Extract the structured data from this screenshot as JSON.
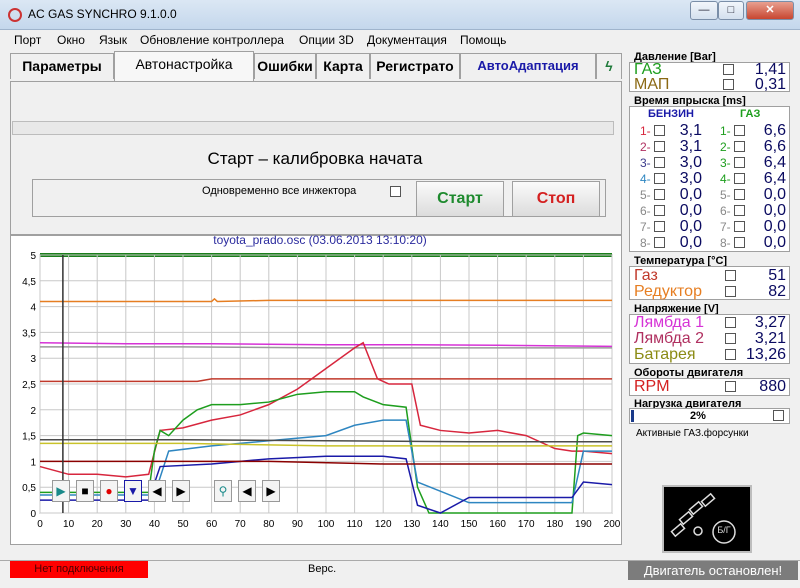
{
  "window": {
    "title": "AC GAS SYNCHRO  9.1.0.0",
    "minimize": "—",
    "maximize": "□",
    "close": "✕"
  },
  "menu": [
    "Порт",
    "Окно",
    "Язык",
    "Обновление контроллера",
    "Опции 3D",
    "Документация",
    "Помощь"
  ],
  "tabs": [
    "Параметры",
    "Автонастройка",
    "Ошибки",
    "Карта",
    "Регистрато",
    "АвтоАдаптация"
  ],
  "autotune": {
    "status": "Старт – калибровка начата",
    "all_injectors_label": "Одновременно все инжектора",
    "start_label": "Старт",
    "stop_label": "Стоп"
  },
  "chart_header": "toyota_prado.osc   (03.06.2013 13:10:20)",
  "chart_data": {
    "type": "line",
    "ylim": [
      0,
      5
    ],
    "xlim": [
      0,
      200
    ],
    "xticks": [
      "0",
      "10",
      "20",
      "30",
      "40",
      "50",
      "60",
      "70",
      "80",
      "90",
      "100",
      "110",
      "120",
      "130",
      "140",
      "150",
      "160",
      "170",
      "180",
      "190",
      "200"
    ],
    "yticks": [
      "0",
      "0,5",
      "1",
      "1,5",
      "2",
      "2,5",
      "3",
      "3,5",
      "4",
      "4,5",
      "5"
    ],
    "cursor_x": 8,
    "series": [
      {
        "color": "#e67e22",
        "x": [
          0,
          20,
          40,
          60,
          61,
          62,
          80,
          100,
          130,
          160,
          200
        ],
        "y": [
          4.1,
          4.1,
          4.1,
          4.1,
          4.15,
          4.1,
          4.12,
          4.12,
          4.12,
          4.12,
          4.12
        ]
      },
      {
        "color": "#d633d6",
        "x": [
          0,
          30,
          60,
          100,
          130,
          160,
          200
        ],
        "y": [
          3.3,
          3.28,
          3.28,
          3.26,
          3.26,
          3.25,
          3.23
        ]
      },
      {
        "color": "#9a9a9a",
        "x": [
          0,
          50,
          100,
          150,
          200
        ],
        "y": [
          3.22,
          3.22,
          3.2,
          3.2,
          3.2
        ]
      },
      {
        "color": "#c0392b",
        "x": [
          0,
          50,
          55,
          60,
          80,
          100,
          112,
          114,
          118,
          130,
          160,
          200
        ],
        "y": [
          2.55,
          2.55,
          2.55,
          2.6,
          2.6,
          2.6,
          2.6,
          2.6,
          2.6,
          2.6,
          2.6,
          2.6
        ]
      },
      {
        "color": "#d7263d",
        "x": [
          0,
          10,
          20,
          30,
          38,
          42,
          50,
          60,
          70,
          80,
          90,
          100,
          110,
          113,
          118,
          122,
          130,
          133,
          140,
          150,
          160,
          170,
          180,
          186,
          190,
          200
        ],
        "y": [
          0.9,
          0.75,
          0.75,
          0.7,
          0.75,
          1.6,
          1.65,
          1.8,
          1.9,
          2.1,
          2.4,
          2.8,
          3.2,
          3.3,
          2.6,
          2.5,
          2.5,
          1.7,
          1.6,
          1.55,
          1.6,
          1.5,
          1.25,
          1.2,
          1.2,
          1.15
        ]
      },
      {
        "color": "#1e9e1e",
        "x": [
          0,
          38,
          40,
          42,
          45,
          50,
          55,
          60,
          70,
          80,
          90,
          100,
          110,
          113,
          120,
          128,
          132,
          136,
          150,
          170,
          186,
          188,
          190,
          200
        ],
        "y": [
          0.4,
          0.4,
          1.2,
          1.6,
          1.5,
          1.8,
          2.0,
          2.1,
          2.1,
          2.15,
          2.3,
          2.35,
          2.35,
          2.25,
          2.1,
          2.05,
          0.5,
          0.0,
          0.0,
          0.0,
          0.0,
          1.5,
          1.55,
          1.5
        ]
      },
      {
        "color": "#2e86c1",
        "x": [
          0,
          40,
          45,
          60,
          80,
          100,
          110,
          120,
          128,
          132,
          150,
          160,
          186,
          190,
          200
        ],
        "y": [
          0.35,
          0.35,
          1.2,
          1.3,
          1.4,
          1.5,
          1.7,
          1.8,
          1.8,
          0.6,
          0.2,
          0.2,
          0.2,
          1.2,
          1.2
        ]
      },
      {
        "color": "#1a1aa8",
        "x": [
          0,
          38,
          42,
          60,
          80,
          100,
          120,
          128,
          132,
          140,
          150,
          160,
          186,
          190,
          200
        ],
        "y": [
          0.25,
          0.25,
          0.9,
          0.95,
          1.05,
          1.1,
          1.1,
          1.05,
          0.15,
          0.0,
          0.3,
          0.3,
          0.3,
          0.6,
          0.55
        ]
      },
      {
        "color": "#c9c22a",
        "x": [
          0,
          50,
          100,
          150,
          200
        ],
        "y": [
          1.35,
          1.35,
          1.3,
          1.3,
          1.3
        ]
      },
      {
        "color": "#4b4b4b",
        "x": [
          0,
          50,
          100,
          150,
          200
        ],
        "y": [
          1.42,
          1.42,
          1.4,
          1.38,
          1.38
        ]
      },
      {
        "color": "#8b0000",
        "x": [
          0,
          40,
          80,
          120,
          160,
          200
        ],
        "y": [
          1.0,
          1.0,
          1.0,
          0.95,
          0.95,
          0.95
        ]
      }
    ]
  },
  "pressure": {
    "title": "Давление [Bar]",
    "gas_label": "ГАЗ",
    "gas_value": "1,41",
    "map_label": "МАП",
    "map_value": "0,31"
  },
  "injection": {
    "title": "Время впрыска [ms]",
    "petrol_label": "БЕНЗИН",
    "gas_label": "ГАЗ",
    "rows": [
      {
        "n": "1",
        "petrol": "3,1",
        "gas": "6,6",
        "active": true
      },
      {
        "n": "2",
        "petrol": "3,1",
        "gas": "6,6",
        "active": true
      },
      {
        "n": "3",
        "petrol": "3,0",
        "gas": "6,4",
        "active": true
      },
      {
        "n": "4",
        "petrol": "3,0",
        "gas": "6,4",
        "active": true
      },
      {
        "n": "5",
        "petrol": "0,0",
        "gas": "0,0",
        "active": false
      },
      {
        "n": "6",
        "petrol": "0,0",
        "gas": "0,0",
        "active": false
      },
      {
        "n": "7",
        "petrol": "0,0",
        "gas": "0,0",
        "active": false
      },
      {
        "n": "8",
        "petrol": "0,0",
        "gas": "0,0",
        "active": false
      }
    ],
    "colors": [
      "#d7263d",
      "#b03060",
      "#3c3c8c",
      "#2e86c1",
      "#888888",
      "#888888",
      "#888888",
      "#888888"
    ],
    "gas_colors": [
      "#1e9e1e",
      "#1e9e1e",
      "#1e9e1e",
      "#1e9e1e",
      "#888888",
      "#888888",
      "#888888",
      "#888888"
    ]
  },
  "temperature": {
    "title": "Температура [°C]",
    "gas_label": "Газ",
    "gas_value": "51",
    "reducer_label": "Редуктор",
    "reducer_value": "82"
  },
  "voltage": {
    "title": "Напряжение [V]",
    "lambda1_label": "Лямбда 1",
    "lambda1_value": "3,27",
    "lambda2_label": "Лямбда 2",
    "lambda2_value": "3,21",
    "battery_label": "Батарея",
    "battery_value": "13,26"
  },
  "rpm": {
    "title": "Обороты двигателя",
    "label": "RPM",
    "value": "880"
  },
  "load": {
    "title": "Нагрузка двигателя",
    "value": "2%",
    "fraction": 0.02
  },
  "active_injectors": "Активные ГАЗ.форсунки",
  "mode_indicator": "Б/Г",
  "status": {
    "connection": "Нет подключения",
    "version": "Верс.",
    "engine": "Двигатель остановлен!"
  }
}
